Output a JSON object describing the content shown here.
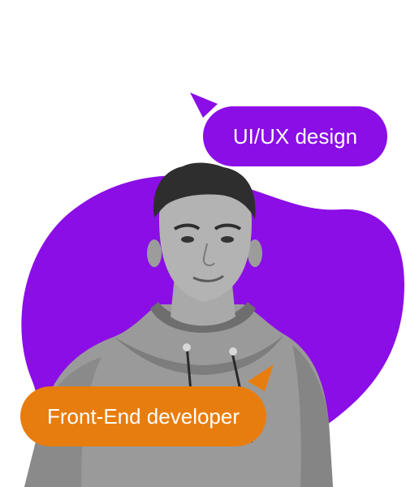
{
  "colors": {
    "purple": "#8b0ee6",
    "orange": "#e87d0f",
    "background": "#ffffff"
  },
  "bubbles": {
    "design_label": "UI/UX design",
    "dev_label": "Front-End developer"
  },
  "portrait": {
    "icon": "person-portrait-icon"
  }
}
